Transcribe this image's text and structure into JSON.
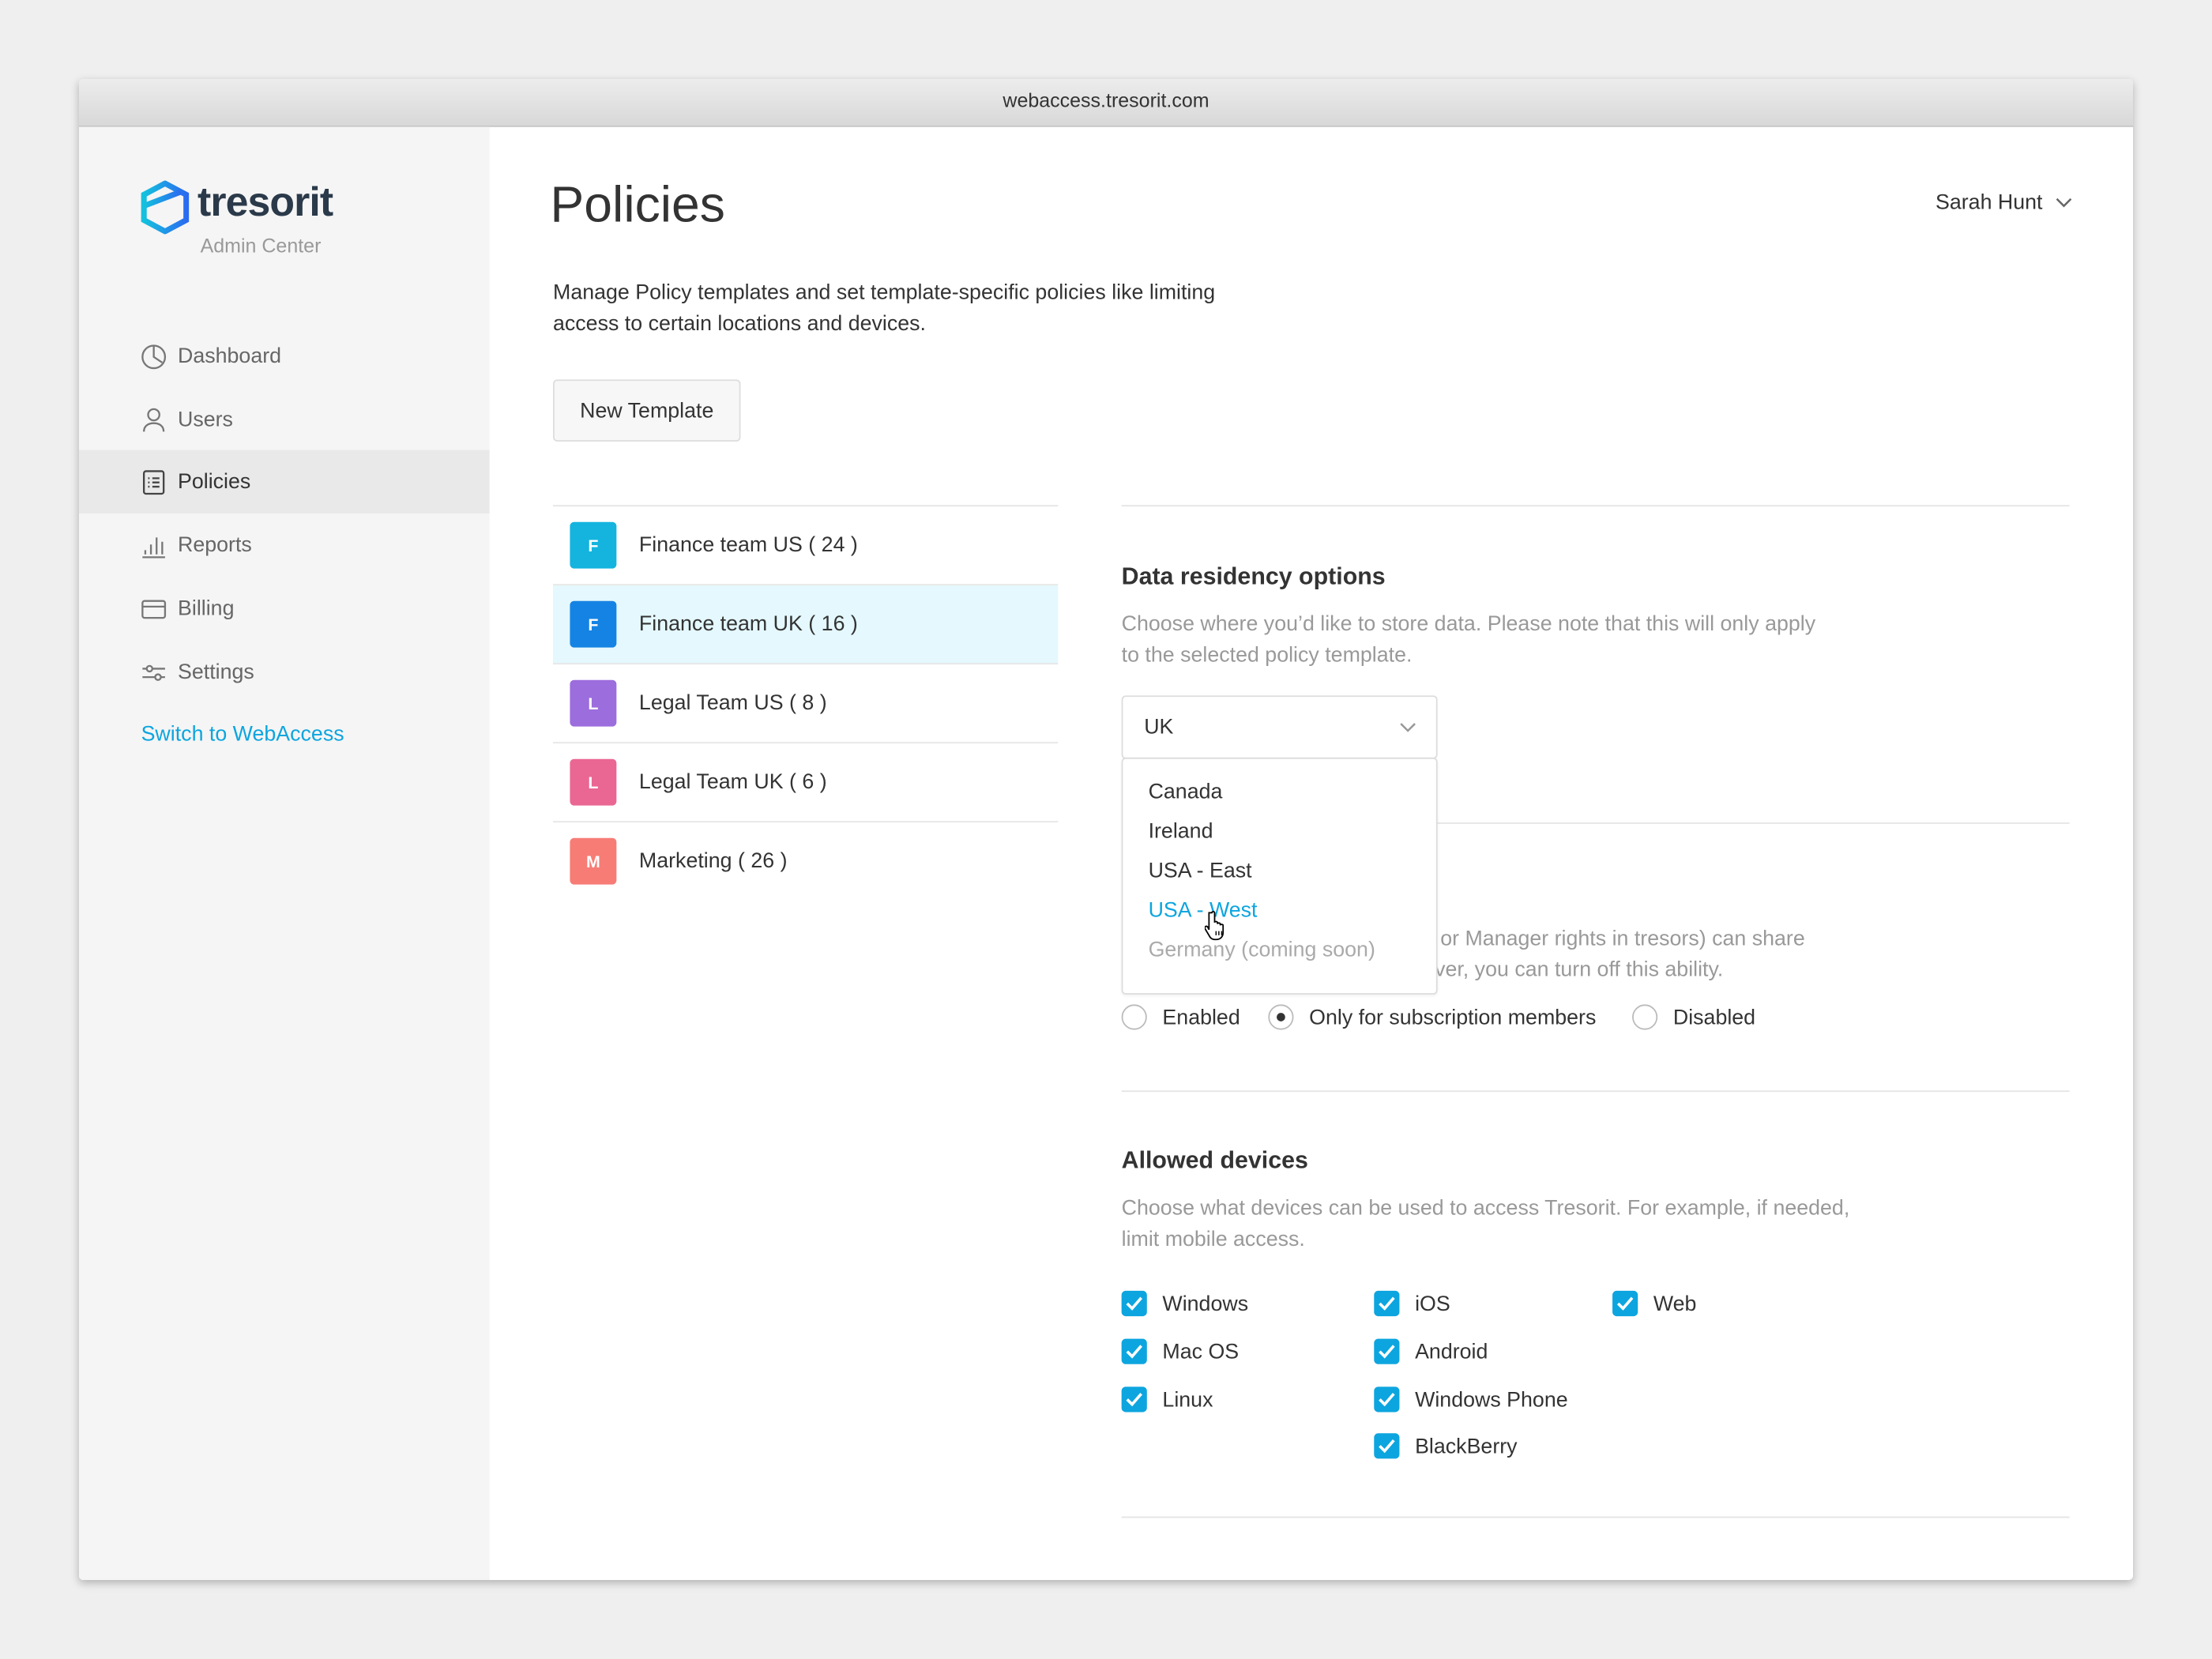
{
  "browser": {
    "url": "webaccess.tresorit.com"
  },
  "brand": {
    "name": "tresorit",
    "subtitle": "Admin Center",
    "accent": "#0da5df"
  },
  "sidebar": {
    "items": [
      {
        "label": "Dashboard",
        "icon": "pie-chart-icon"
      },
      {
        "label": "Users",
        "icon": "user-icon"
      },
      {
        "label": "Policies",
        "icon": "list-icon",
        "active": true
      },
      {
        "label": "Reports",
        "icon": "bar-chart-icon"
      },
      {
        "label": "Billing",
        "icon": "credit-card-icon"
      },
      {
        "label": "Settings",
        "icon": "sliders-icon"
      }
    ],
    "switch_link": "Switch to WebAccess"
  },
  "header": {
    "title": "Policies",
    "user": "Sarah Hunt"
  },
  "intro": {
    "line1": "Manage Policy templates and set template-specific policies like limiting",
    "line2": "access to certain locations and devices.",
    "new_template": "New Template"
  },
  "templates": [
    {
      "initial": "F",
      "label": "Finance team US ( 24 )",
      "color": "#14b4de"
    },
    {
      "initial": "F",
      "label": "Finance team UK ( 16 )",
      "color": "#1583e3",
      "selected": true
    },
    {
      "initial": "L",
      "label": "Legal Team US ( 8 )",
      "color": "#9c6ddd"
    },
    {
      "initial": "L",
      "label": "Legal Team UK ( 6 )",
      "color": "#ea6793"
    },
    {
      "initial": "M",
      "label": "Marketing ( 26 )",
      "color": "#f77c76"
    }
  ],
  "residency": {
    "title": "Data residency options",
    "desc1": "Choose where you’d like to store data. Please note that this will only apply",
    "desc2": "to the selected policy template.",
    "selected": "UK",
    "options": [
      "Canada",
      "Ireland",
      "USA - East",
      "USA - West",
      "Germany (coming soon)"
    ]
  },
  "sharing": {
    "desc1": "or Manager rights in tresors) can share",
    "desc2": "ver, you can turn off this ability.",
    "options": [
      "Enabled",
      "Only for subscription members",
      "Disabled"
    ],
    "selected": "Only for subscription members"
  },
  "devices": {
    "title": "Allowed devices",
    "desc1": "Choose what devices can be used to access Tresorit. For example, if needed,",
    "desc2": "limit mobile access.",
    "items": [
      "Windows",
      "Mac OS",
      "Linux",
      "iOS",
      "Android",
      "Windows Phone",
      "BlackBerry",
      "Web"
    ]
  }
}
